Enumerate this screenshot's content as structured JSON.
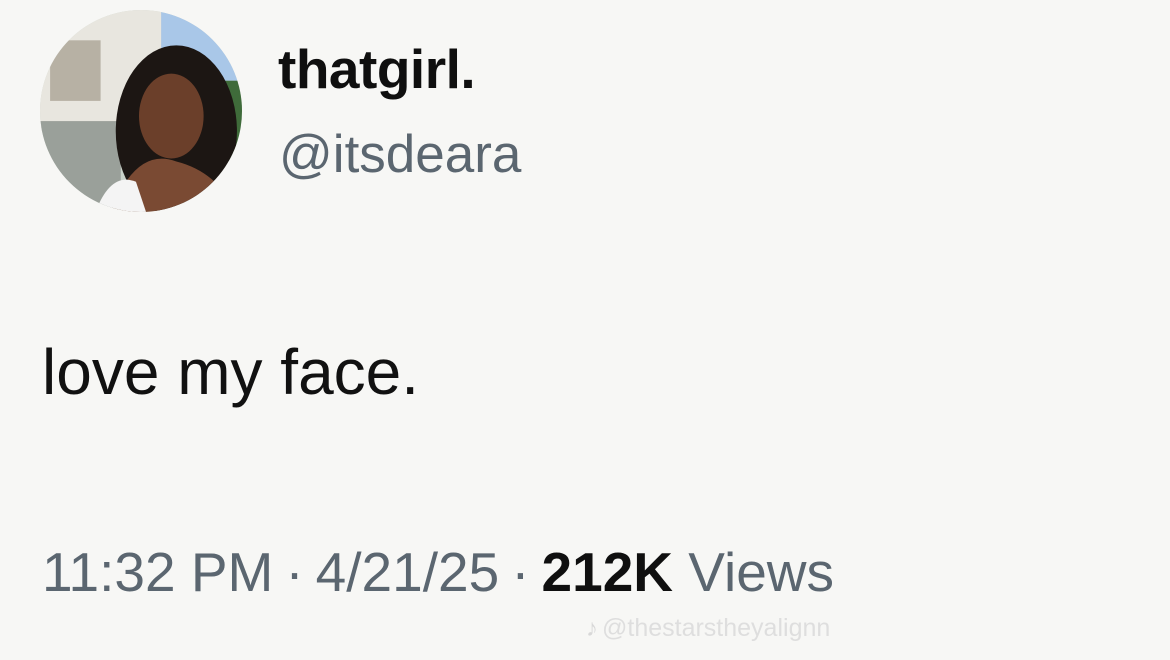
{
  "user": {
    "display_name": "thatgirl.",
    "handle": "@itsdeara",
    "avatar_icon": "profile-photo"
  },
  "post": {
    "text": "love my face."
  },
  "meta": {
    "time": "11:32 PM",
    "separator": "·",
    "date": "4/21/25",
    "views_count": "212K",
    "views_label": "Views"
  },
  "watermark": {
    "icon": "tiktok-icon",
    "text": "@thestarstheyalignn"
  }
}
